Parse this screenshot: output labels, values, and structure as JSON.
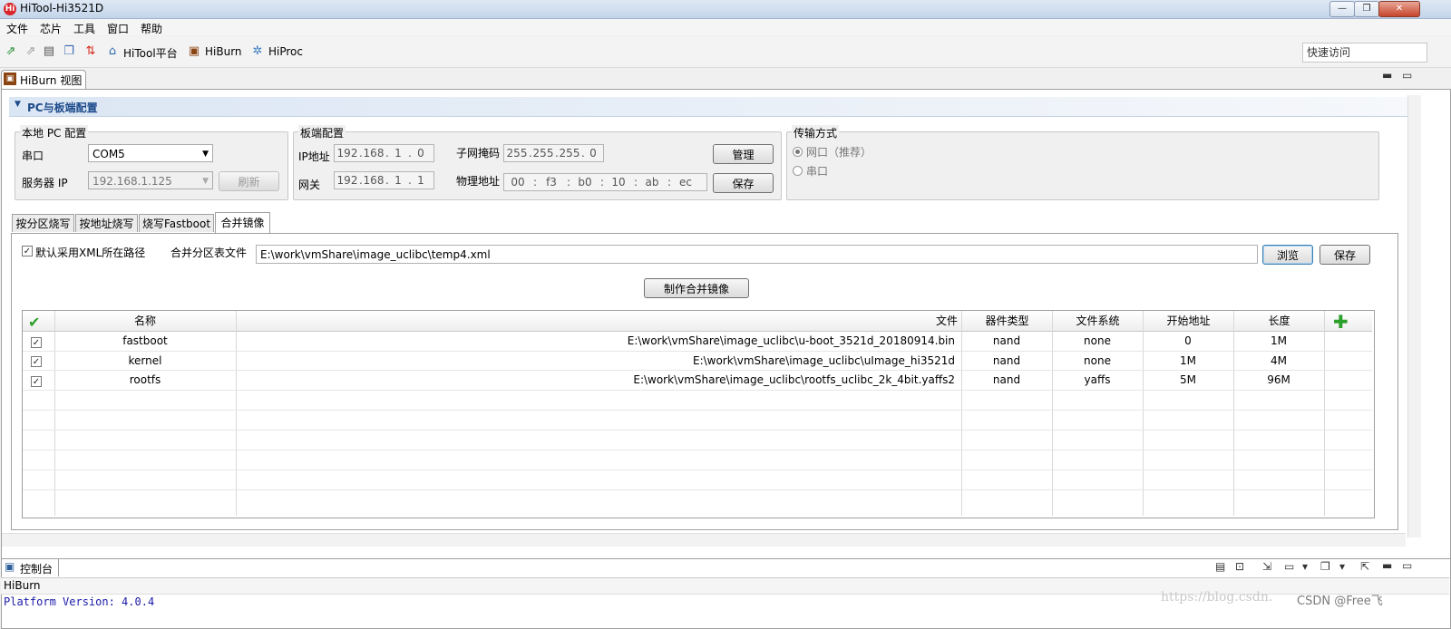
{
  "window": {
    "title": "HiTool-Hi3521D",
    "app_icon_letter": "Hi",
    "minimize": "—",
    "maximize": "❐",
    "close": "✕"
  },
  "menu": [
    "文件",
    "芯片",
    "工具",
    "窗口",
    "帮助"
  ],
  "toolbar": {
    "items": [
      {
        "label": "HiTool平台",
        "icon": "house-icon"
      },
      {
        "label": "HiBurn",
        "icon": "burn-icon"
      },
      {
        "label": "HiProc",
        "icon": "proc-icon"
      }
    ],
    "quick_access_placeholder": "快速访问"
  },
  "view_tab": {
    "label": "HiBurn 视图"
  },
  "section": {
    "title": "PC与板端配置"
  },
  "local_pc": {
    "title": "本地 PC 配置",
    "serial_label": "串口",
    "serial_value": "COM5",
    "server_ip_label": "服务器 IP",
    "server_ip_value": "192.168.1.125",
    "refresh_button": "刷新"
  },
  "board": {
    "title": "板端配置",
    "ip_label": "IP地址",
    "ip": [
      "192",
      "168",
      "1",
      "0"
    ],
    "gateway_label": "网关",
    "gateway": [
      "192",
      "168",
      "1",
      "1"
    ],
    "netmask_label": "子网掩码",
    "netmask": [
      "255",
      "255",
      "255",
      "0"
    ],
    "mac_label": "物理地址",
    "mac": [
      "00",
      "f3",
      "b0",
      "10",
      "ab",
      "ec"
    ],
    "manage_button": "管理",
    "save_button": "保存"
  },
  "transfer": {
    "title": "传输方式",
    "option_network": "网口（推荐）",
    "option_serial": "串口"
  },
  "tabs": [
    "按分区烧写",
    "按地址烧写",
    "烧写Fastboot",
    "合并镜像"
  ],
  "merge": {
    "default_xml_label": "默认采用XML所在路径",
    "partition_file_label": "合并分区表文件",
    "xml_path": "E:\\work\\vmShare\\image_uclibc\\temp4.xml",
    "browse_button": "浏览",
    "save_button": "保存",
    "make_button": "制作合并镜像"
  },
  "table": {
    "headers": [
      "名称",
      "文件",
      "器件类型",
      "文件系统",
      "开始地址",
      "长度"
    ],
    "rows": [
      {
        "name": "fastboot",
        "file": "E:\\work\\vmShare\\image_uclibc\\u-boot_3521d_20180914.bin",
        "device": "nand",
        "fs": "none",
        "start": "0",
        "length": "1M"
      },
      {
        "name": "kernel",
        "file": "E:\\work\\vmShare\\image_uclibc\\uImage_hi3521d",
        "device": "nand",
        "fs": "none",
        "start": "1M",
        "length": "4M"
      },
      {
        "name": "rootfs",
        "file": "E:\\work\\vmShare\\image_uclibc\\rootfs_uclibc_2k_4bit.yaffs2",
        "device": "nand",
        "fs": "yaffs",
        "start": "5M",
        "length": "96M"
      }
    ]
  },
  "console": {
    "tab_label": "控制台",
    "header": "HiBurn",
    "lines": [
      "Platform Version: 4.0.4"
    ]
  },
  "watermark": {
    "url": "https://blog.csdn.",
    "csdn": "CSDN @Free飞"
  },
  "colors": {
    "accent": "#1c4a8a",
    "console_text": "#1a1aa8"
  }
}
